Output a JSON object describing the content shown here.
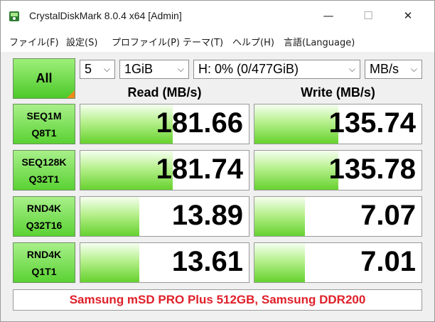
{
  "window": {
    "title": "CrystalDiskMark 8.0.4 x64 [Admin]",
    "buttons": [
      "—",
      "☐",
      "✕"
    ]
  },
  "menu": [
    "ファイル(F)",
    "設定(S)",
    "プロファイル(P)",
    "テーマ(T)",
    "ヘルプ(H)",
    "言語(Language)"
  ],
  "controls": {
    "all_label": "All",
    "count": "5",
    "size": "1GiB",
    "drive": "H: 0% (0/477GiB)",
    "unit": "MB/s"
  },
  "headers": {
    "read": "Read (MB/s)",
    "write": "Write (MB/s)"
  },
  "rows": [
    {
      "line1": "SEQ1M",
      "line2": "Q8T1",
      "read": "181.66",
      "write": "135.74",
      "read_fill": 0.55,
      "write_fill": 0.5
    },
    {
      "line1": "SEQ128K",
      "line2": "Q32T1",
      "read": "181.74",
      "write": "135.78",
      "read_fill": 0.55,
      "write_fill": 0.5
    },
    {
      "line1": "RND4K",
      "line2": "Q32T16",
      "read": "13.89",
      "write": "7.07",
      "read_fill": 0.35,
      "write_fill": 0.3
    },
    {
      "line1": "RND4K",
      "line2": "Q1T1",
      "read": "13.61",
      "write": "7.01",
      "read_fill": 0.35,
      "write_fill": 0.3
    }
  ],
  "comment": "Samsung mSD PRO Plus 512GB, Samsung DDR200",
  "colors": {
    "accent_green": "#4cc929",
    "comment_red": "#e0202a",
    "corner_orange": "#f08a1a"
  }
}
